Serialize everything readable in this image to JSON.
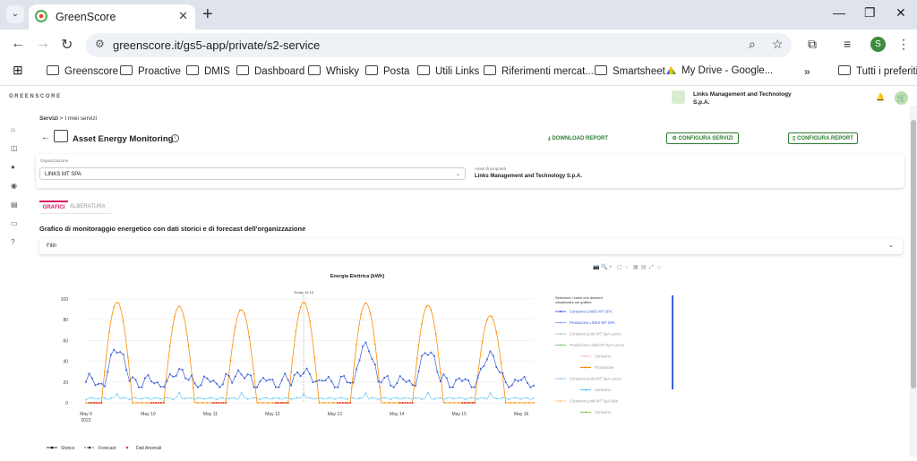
{
  "browser": {
    "tab_title": "GreenScore",
    "url": "greenscore.it/gs5-app/private/s2-service",
    "profile_initial": "S",
    "bookmarks": [
      "Greenscore",
      "Proactive",
      "DMIS",
      "Dashboard",
      "Whisky",
      "Posta",
      "Utili Links",
      "Riferimenti mercat...",
      "Smartsheet",
      "My Drive - Google...",
      "Tutti i preferiti"
    ]
  },
  "app": {
    "logo": "GREENSCORE",
    "org_name": "Links Management and Technology S.p.A.",
    "breadcrumb_root": "Servizi",
    "breadcrumb_sep": " > ",
    "breadcrumb_current": "I miei servizi",
    "page_title": "Asset Energy Monitoring",
    "download_label": "DOWNLOAD REPORT",
    "config_services_label": "CONFIGURA SERVIZI",
    "config_report_label": "CONFIGURA REPORT",
    "org_field_label": "Organizzazione",
    "org_field_value": "LINKS MT SPA",
    "asset_field_label": "Asset di proprietà",
    "asset_field_value": "Links Management and Technology S.p.A.",
    "tabs": [
      "GRAFICI",
      "ALBERATURA"
    ],
    "section_title": "Grafico di monitoraggio energetico con dati storici e di forecast dell'organizzazione",
    "filters_label": "Filtri"
  },
  "chart_data": {
    "type": "line",
    "title": "Energia Elettrica [kWh]",
    "annotation": "Today 12:15",
    "ylim": [
      0,
      100
    ],
    "y_ticks": [
      0,
      20,
      40,
      60,
      80,
      100
    ],
    "x_ticks": [
      "May 9\n2023",
      "May 10",
      "May 11",
      "May 12",
      "May 13",
      "May 14",
      "May 15",
      "May 16"
    ],
    "legend_header": "Selezione i valori che desideri visualizzare sul grafico:",
    "legend_items": [
      {
        "label": "Consumo LINKS MT SPA",
        "color": "#3b5fd9"
      },
      {
        "label": "Produzione LINKS MT SPA",
        "color": "#8fa5f2"
      },
      {
        "label": "Consumo Links MT SpA-Lecce",
        "color": "#a5d6a7"
      },
      {
        "label": "Produzione Links MT SpA-Lecce",
        "color": "#81c784"
      },
      {
        "label": "Consumo",
        "color": "#f8bbd0"
      },
      {
        "label": "Produzione",
        "color": "#ff8c00"
      },
      {
        "label": "Consumo Links MT SpA-Lecce",
        "color": "#90caf9"
      },
      {
        "label": "Consumo",
        "color": "#4fc3f7"
      },
      {
        "label": "Consumo Links MT SpA-Bari",
        "color": "#ffcc80"
      },
      {
        "label": "Consumo",
        "color": "#8bc34a"
      }
    ],
    "bottom_legend": [
      {
        "label": "Storico",
        "color": "#000000"
      },
      {
        "label": "Forecast",
        "color": "#333333"
      },
      {
        "label": "Dati Anomali",
        "color": "#e53935"
      }
    ],
    "series": [
      {
        "name": "Produzione",
        "color": "#ff8c00",
        "peaks": [
          97,
          93,
          90,
          97,
          96,
          94,
          84
        ]
      },
      {
        "name": "Consumo LINKS MT SPA",
        "color": "#3b5fd9",
        "day_levels": [
          52,
          30,
          28,
          30,
          55,
          50,
          46,
          40
        ]
      },
      {
        "name": "Consumo",
        "color": "#4fc3f7",
        "base": 3
      }
    ]
  }
}
